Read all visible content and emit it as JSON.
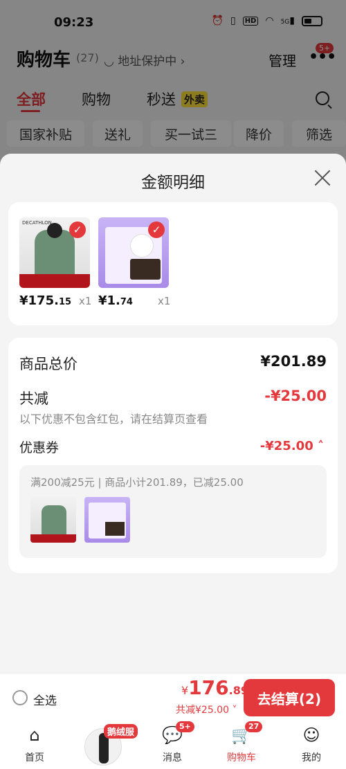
{
  "status": {
    "time": "09:23",
    "network": "5G"
  },
  "header": {
    "title": "购物车",
    "count": "(27)",
    "address": "地址保护中",
    "manage": "管理",
    "more_badge": "5+"
  },
  "tabs": [
    {
      "label": "全部"
    },
    {
      "label": "购物"
    },
    {
      "label": "秒送"
    }
  ],
  "tab_tag": "外卖",
  "chips": [
    "国家补贴",
    "送礼",
    "买一试三",
    "降价",
    "筛选"
  ],
  "sheet": {
    "title": "金额明细",
    "products": [
      {
        "name": "jacket",
        "brand": "DECATHLON",
        "price_int": "¥175.",
        "price_dec": "15",
        "qty": "x1"
      },
      {
        "name": "dog-food",
        "price_int": "¥1.",
        "price_dec": "74",
        "qty": "x1"
      }
    ],
    "summary": {
      "total_label": "商品总价",
      "total_value": "¥201.89",
      "discount_label": "共减",
      "discount_value": "-¥25.00",
      "discount_note": "以下优惠不包含红包，请在结算页查看",
      "coupon_label": "优惠券",
      "coupon_value": "-¥25.00",
      "coupon_detail": "满200减25元 | 商品小计201.89，已减25.00"
    }
  },
  "bottom_bar": {
    "select_all": "全选",
    "currency": "¥",
    "total_big": "176",
    "total_dec": ".89",
    "saved": "共减¥25.00",
    "checkout": "去结算(2)"
  },
  "tabbar": {
    "home": "首页",
    "promo_tag": "鹅绒服",
    "messages": "消息",
    "messages_badge": "5+",
    "cart": "购物车",
    "cart_badge": "27",
    "me": "我的"
  },
  "colors": {
    "accent": "#e4393c",
    "tag_yellow": "#ffe13a"
  }
}
